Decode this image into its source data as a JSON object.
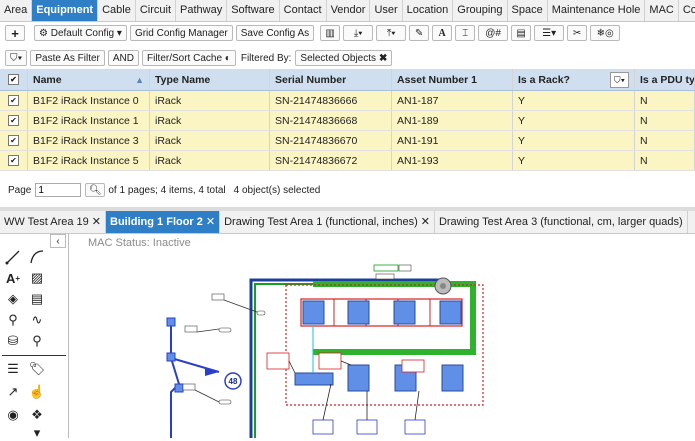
{
  "topnav": {
    "tabs": [
      "Area",
      "Equipment",
      "Cable",
      "Circuit",
      "Pathway",
      "Software",
      "Contact",
      "Vendor",
      "User",
      "Location",
      "Grouping",
      "Space",
      "Maintenance Hole",
      "MAC",
      "Contr"
    ]
  },
  "toolbar": {
    "add_icon": "+",
    "default_config": "Default Config",
    "grid_config_manager": "Grid Config Manager",
    "save_config_as": "Save Config As"
  },
  "filterbar": {
    "paste_as_filter": "Paste As Filter",
    "and": "AND",
    "filter_sort_cache": "Filter/Sort Cache",
    "filtered_by_label": "Filtered By:",
    "filter_chip": "Selected Objects"
  },
  "grid": {
    "columns": [
      "Name",
      "Type Name",
      "Serial Number",
      "Asset Number 1",
      "Is a Rack?",
      "Is a PDU type"
    ],
    "rows": [
      {
        "name": "B1F2 iRack Instance 0",
        "type": "iRack",
        "serial": "SN-21474836666",
        "asset": "AN1-187",
        "rack": "Y",
        "pdu": "N"
      },
      {
        "name": "B1F2 iRack Instance 1",
        "type": "iRack",
        "serial": "SN-21474836668",
        "asset": "AN1-189",
        "rack": "Y",
        "pdu": "N"
      },
      {
        "name": "B1F2 iRack Instance 3",
        "type": "iRack",
        "serial": "SN-21474836670",
        "asset": "AN1-191",
        "rack": "Y",
        "pdu": "N"
      },
      {
        "name": "B1F2 iRack Instance 5",
        "type": "iRack",
        "serial": "SN-21474836672",
        "asset": "AN1-193",
        "rack": "Y",
        "pdu": "N"
      }
    ]
  },
  "pager": {
    "label": "Page",
    "value": "1",
    "of_text": "of 1 pages; 4 items, 4 total",
    "selected": "4 object(s) selected"
  },
  "drawing_tabs": [
    "WW Test Area 19",
    "Building 1 Floor 2",
    "Drawing Test Area 1 (functional, inches)",
    "Drawing Test Area 3 (functional, cm, larger quads)"
  ],
  "canvas": {
    "mac_status": "MAC Status: Inactive",
    "badge": "48"
  }
}
